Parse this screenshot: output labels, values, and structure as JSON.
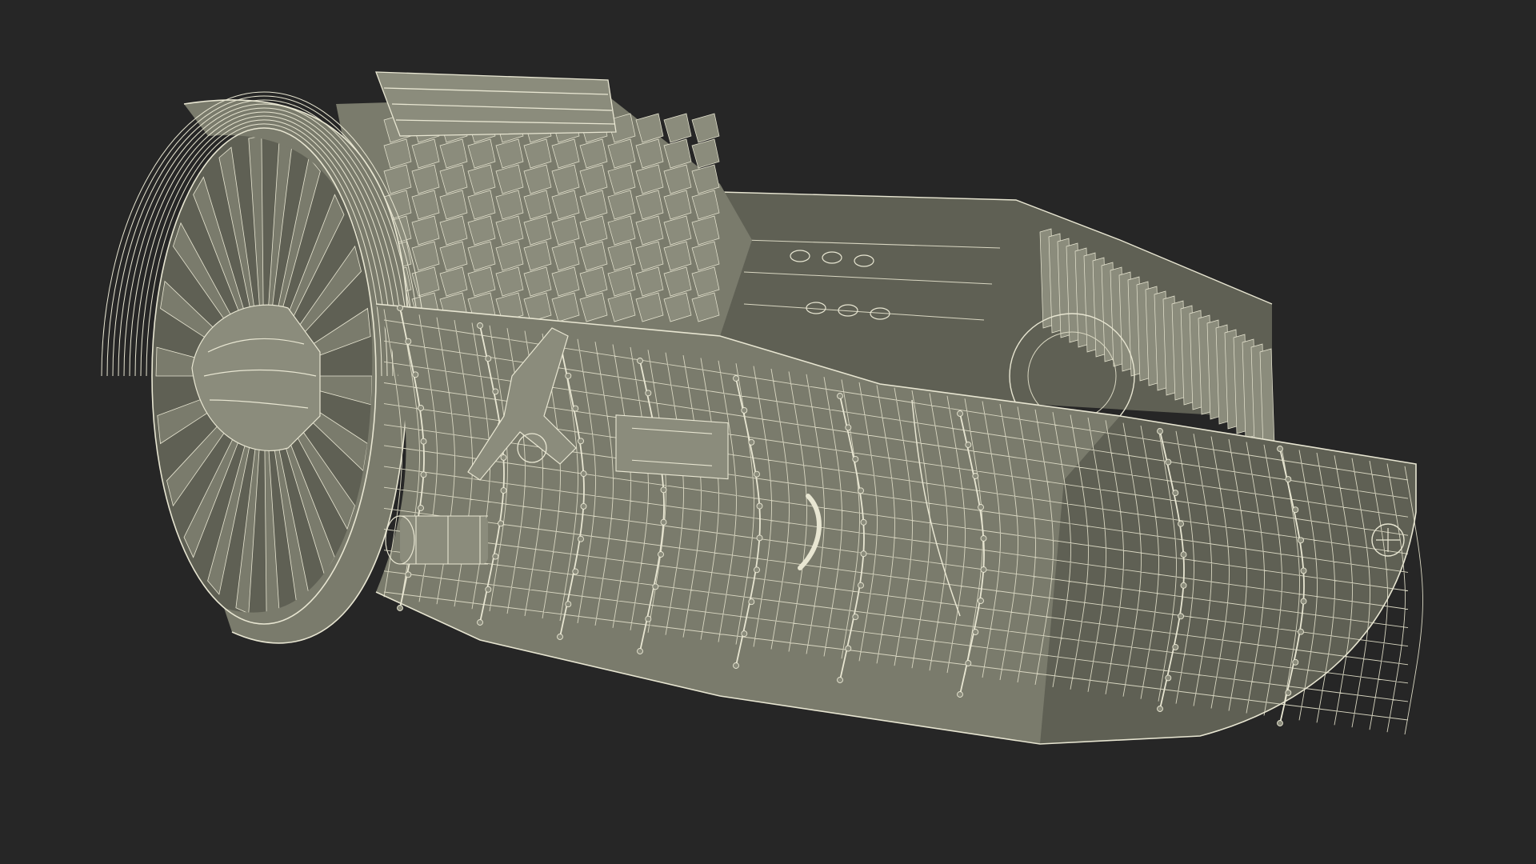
{
  "scene": {
    "background_color": "#262626",
    "surface_color": "#7a7b6c",
    "surface_dark_color": "#5f6054",
    "surface_light_color": "#8b8c7c",
    "wire_color": "#e8e6d2",
    "subject": "wireframe-turbofan-engine-cutaway"
  }
}
